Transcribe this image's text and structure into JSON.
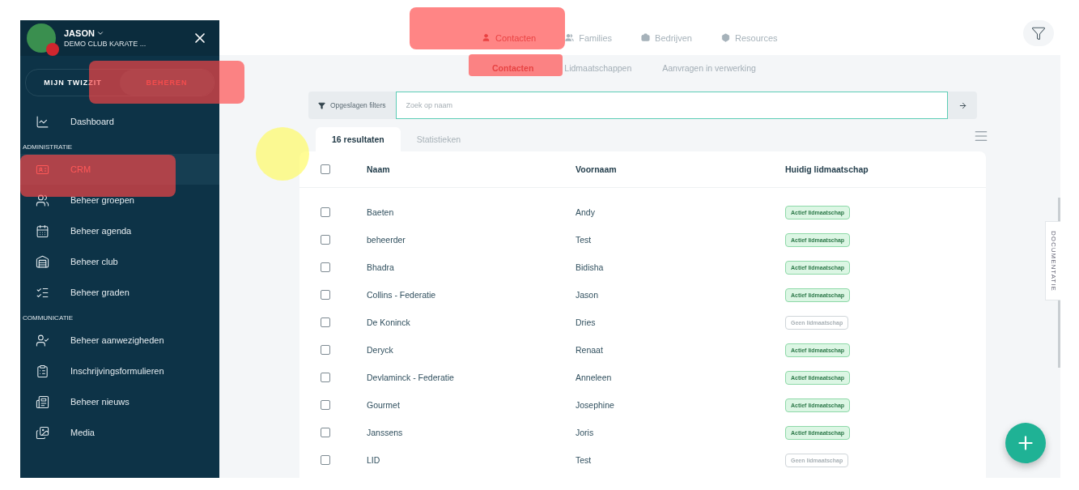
{
  "user": {
    "name": "JASON",
    "club": "DEMO CLUB KARATE ..."
  },
  "mode_switch": [
    {
      "label": "MIJN TWIZZIT",
      "selected": false
    },
    {
      "label": "BEHEREN",
      "selected": true
    }
  ],
  "sidebar": {
    "top_items": [
      {
        "label": "Dashboard",
        "selected": false
      }
    ],
    "sections": [
      {
        "title": "ADMINISTRATIE",
        "items": [
          {
            "label": "CRM",
            "selected": true
          },
          {
            "label": "Beheer groepen",
            "selected": false
          },
          {
            "label": "Beheer agenda",
            "selected": false
          },
          {
            "label": "Beheer club",
            "selected": false
          },
          {
            "label": "Beheer graden",
            "selected": false
          }
        ]
      },
      {
        "title": "COMMUNICATIE",
        "items": [
          {
            "label": "Beheer aanwezigheden",
            "selected": false
          },
          {
            "label": "Inschrijvingsformulieren",
            "selected": false
          },
          {
            "label": "Beheer nieuws",
            "selected": false
          },
          {
            "label": "Media",
            "selected": false
          }
        ]
      }
    ]
  },
  "tabs": [
    {
      "label": "Contacten",
      "selected": true
    },
    {
      "label": "Families",
      "selected": false
    },
    {
      "label": "Bedrijven",
      "selected": false
    },
    {
      "label": "Resources",
      "selected": false
    }
  ],
  "subtabs": [
    {
      "label": "Contacten",
      "selected": true
    },
    {
      "label": "Lidmaatschappen",
      "selected": false
    },
    {
      "label": "Aanvragen in verwerking",
      "selected": false
    }
  ],
  "saved_filters": "Opgeslagen filters",
  "search": {
    "placeholder": "Zoek op naam"
  },
  "result_tabs": [
    {
      "label": "16 resultaten",
      "selected": true
    },
    {
      "label": "Statistieken",
      "selected": false
    }
  ],
  "table": {
    "columns": [
      "Naam",
      "Voornaam",
      "Huidig lidmaatschap"
    ],
    "header_checked": false,
    "rows": [
      {
        "checked": false,
        "naam": "Baeten",
        "voornaam": "Andy",
        "membership": {
          "label": "Actief lidmaatschap",
          "kind": "active"
        }
      },
      {
        "checked": false,
        "naam": "beheerder",
        "voornaam": "Test",
        "membership": {
          "label": "Actief lidmaatschap",
          "kind": "active"
        }
      },
      {
        "checked": false,
        "naam": "Bhadra",
        "voornaam": "Bidisha",
        "membership": {
          "label": "Actief lidmaatschap",
          "kind": "active"
        }
      },
      {
        "checked": false,
        "naam": "Collins - Federatie",
        "voornaam": "Jason",
        "membership": {
          "label": "Actief lidmaatschap",
          "kind": "active"
        }
      },
      {
        "checked": false,
        "naam": "De Koninck",
        "voornaam": "Dries",
        "membership": {
          "label": "Geen lidmaatschap",
          "kind": "none"
        }
      },
      {
        "checked": false,
        "naam": "Deryck",
        "voornaam": "Renaat",
        "membership": {
          "label": "Actief lidmaatschap",
          "kind": "active"
        }
      },
      {
        "checked": false,
        "naam": "Devlaminck - Federatie",
        "voornaam": "Anneleen",
        "membership": {
          "label": "Actief lidmaatschap",
          "kind": "active"
        }
      },
      {
        "checked": false,
        "naam": "Gourmet",
        "voornaam": "Josephine",
        "membership": {
          "label": "Actief lidmaatschap",
          "kind": "active"
        }
      },
      {
        "checked": false,
        "naam": "Janssens",
        "voornaam": "Joris",
        "membership": {
          "label": "Actief lidmaatschap",
          "kind": "active"
        }
      },
      {
        "checked": false,
        "naam": "LID",
        "voornaam": "Test",
        "membership": {
          "label": "Geen lidmaatschap",
          "kind": "none"
        }
      }
    ]
  },
  "side_tab": "DOCUMENTATIE"
}
